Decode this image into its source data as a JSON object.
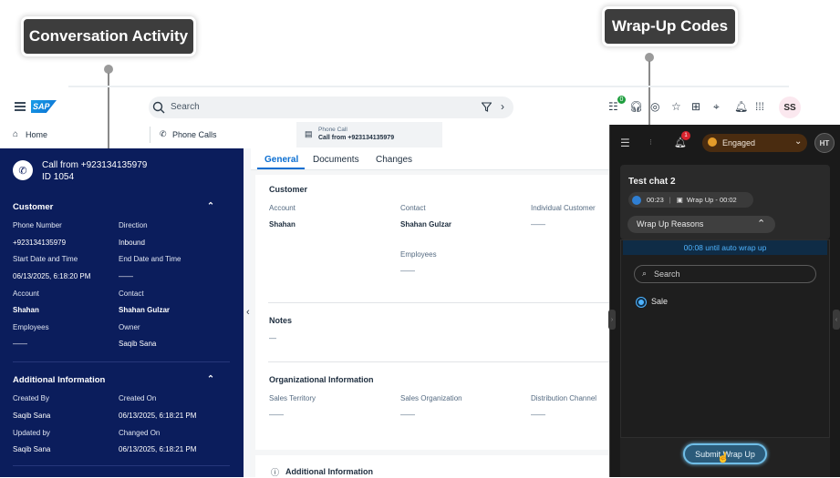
{
  "callouts": {
    "conversation_activity": "Conversation Activity",
    "wrap_up_codes": "Wrap-Up Codes"
  },
  "shell": {
    "logo": "SAP",
    "search_placeholder": "Search",
    "notification_count": "0",
    "avatar_initials": "SS"
  },
  "tabs": {
    "home": "Home",
    "phone_calls": "Phone Calls",
    "active_type": "Phone Call",
    "active_title": "Call from +923134135979"
  },
  "left_panel": {
    "call_title": "Call from +923134135979",
    "call_id": "ID 1054",
    "customer_header": "Customer",
    "phone_number_label": "Phone Number",
    "phone_number": "+923134135979",
    "direction_label": "Direction",
    "direction": "Inbound",
    "start_label": "Start Date and Time",
    "start_value": "06/13/2025, 6:18:20 PM",
    "end_label": "End Date and Time",
    "end_value": "——",
    "account_label": "Account",
    "account": "Shahan",
    "contact_label": "Contact",
    "contact": "Shahan Gulzar",
    "employees_label": "Employees",
    "employees": "——",
    "owner_label": "Owner",
    "owner": "Saqib Sana",
    "additional_header": "Additional Information",
    "created_by_label": "Created By",
    "created_by": "Saqib Sana",
    "created_on_label": "Created On",
    "created_on": "06/13/2025, 6:18:21 PM",
    "updated_by_label": "Updated by",
    "updated_by": "Saqib Sana",
    "changed_on_label": "Changed On",
    "changed_on": "06/13/2025, 6:18:21 PM"
  },
  "main": {
    "tab_general": "General",
    "tab_documents": "Documents",
    "tab_changes": "Changes",
    "customer_title": "Customer",
    "account_label": "Account",
    "account": "Shahan",
    "contact_label": "Contact",
    "contact": "Shahan Gulzar",
    "individual_label": "Individual Customer",
    "individual": "——",
    "employees_label": "Employees",
    "employees": "——",
    "notes_title": "Notes",
    "notes_value": "—",
    "org_title": "Organizational Information",
    "territory_label": "Sales Territory",
    "territory": "——",
    "sales_org_label": "Sales Organization",
    "sales_org": "——",
    "dist_label": "Distribution Channel",
    "dist": "——",
    "additional_partial": "Additional Information"
  },
  "chat": {
    "notif_count": "1",
    "status": "Engaged",
    "agent_initials": "HT",
    "chat_title": "Test chat 2",
    "timer": "00:23",
    "wrap_timer": "Wrap Up - 00:02",
    "wrap_reasons": "Wrap Up Reasons",
    "countdown": "00:08 until auto wrap up",
    "search_placeholder": "Search",
    "option_sale": "Sale",
    "submit": "Submit Wrap Up"
  }
}
